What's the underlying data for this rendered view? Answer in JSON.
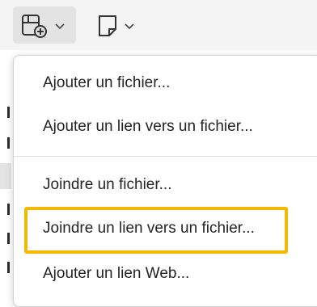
{
  "toolbar": {
    "attach_icon": "attach-file-icon",
    "note_icon": "note-icon",
    "chevron_icon": "chevron-down-icon"
  },
  "menu": {
    "items": [
      {
        "label": "Ajouter un fichier..."
      },
      {
        "label": "Ajouter un lien vers un fichier..."
      },
      {
        "label": "Joindre un fichier..."
      },
      {
        "label": "Joindre un lien vers un fichier..."
      },
      {
        "label": "Ajouter un lien Web..."
      }
    ],
    "highlight_color": "#f5b800"
  }
}
